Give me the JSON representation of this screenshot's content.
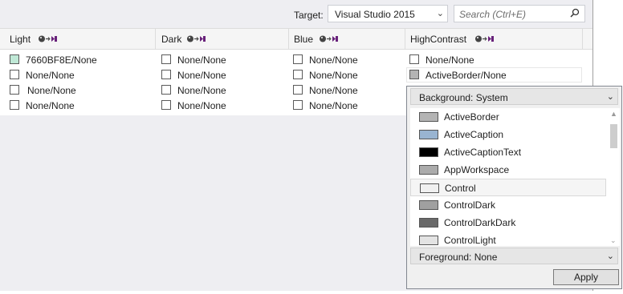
{
  "toolbar": {
    "target_label": "Target:",
    "target_value": "Visual Studio 2015",
    "search_placeholder": "Search (Ctrl+E)"
  },
  "columns": [
    {
      "label": "Light"
    },
    {
      "label": "Dark"
    },
    {
      "label": "Blue"
    },
    {
      "label": "HighContrast"
    }
  ],
  "rows": [
    [
      "7660BF8E/None",
      "None/None",
      "None/None",
      "None/None"
    ],
    [
      "None/None",
      "None/None",
      "None/None",
      "ActiveBorder/None"
    ],
    [
      "None/None",
      "None/None",
      "None/None",
      ""
    ],
    [
      "None/None",
      "None/None",
      "None/None",
      ""
    ]
  ],
  "row_swatch_colors": [
    [
      "#bfe8d6",
      "#ffffff",
      "#ffffff",
      "#ffffff"
    ],
    [
      "#ffffff",
      "#ffffff",
      "#ffffff",
      "#b4b4b4"
    ],
    [
      "#ffffff",
      "#ffffff",
      "#ffffff",
      "#ffffff"
    ],
    [
      "#ffffff",
      "#ffffff",
      "#ffffff",
      "#ffffff"
    ]
  ],
  "popup": {
    "background_combo": "Background: System",
    "foreground_combo": "Foreground: None",
    "apply_label": "Apply",
    "items": [
      {
        "label": "ActiveBorder",
        "color": "#b4b4b4"
      },
      {
        "label": "ActiveCaption",
        "color": "#99b4d1"
      },
      {
        "label": "ActiveCaptionText",
        "color": "#000000"
      },
      {
        "label": "AppWorkspace",
        "color": "#ababab"
      },
      {
        "label": "Control",
        "color": "#f0f0f0"
      },
      {
        "label": "ControlDark",
        "color": "#a0a0a0"
      },
      {
        "label": "ControlDarkDark",
        "color": "#696969"
      },
      {
        "label": "ControlLight",
        "color": "#e3e3e3"
      }
    ],
    "selected_index": 4
  }
}
